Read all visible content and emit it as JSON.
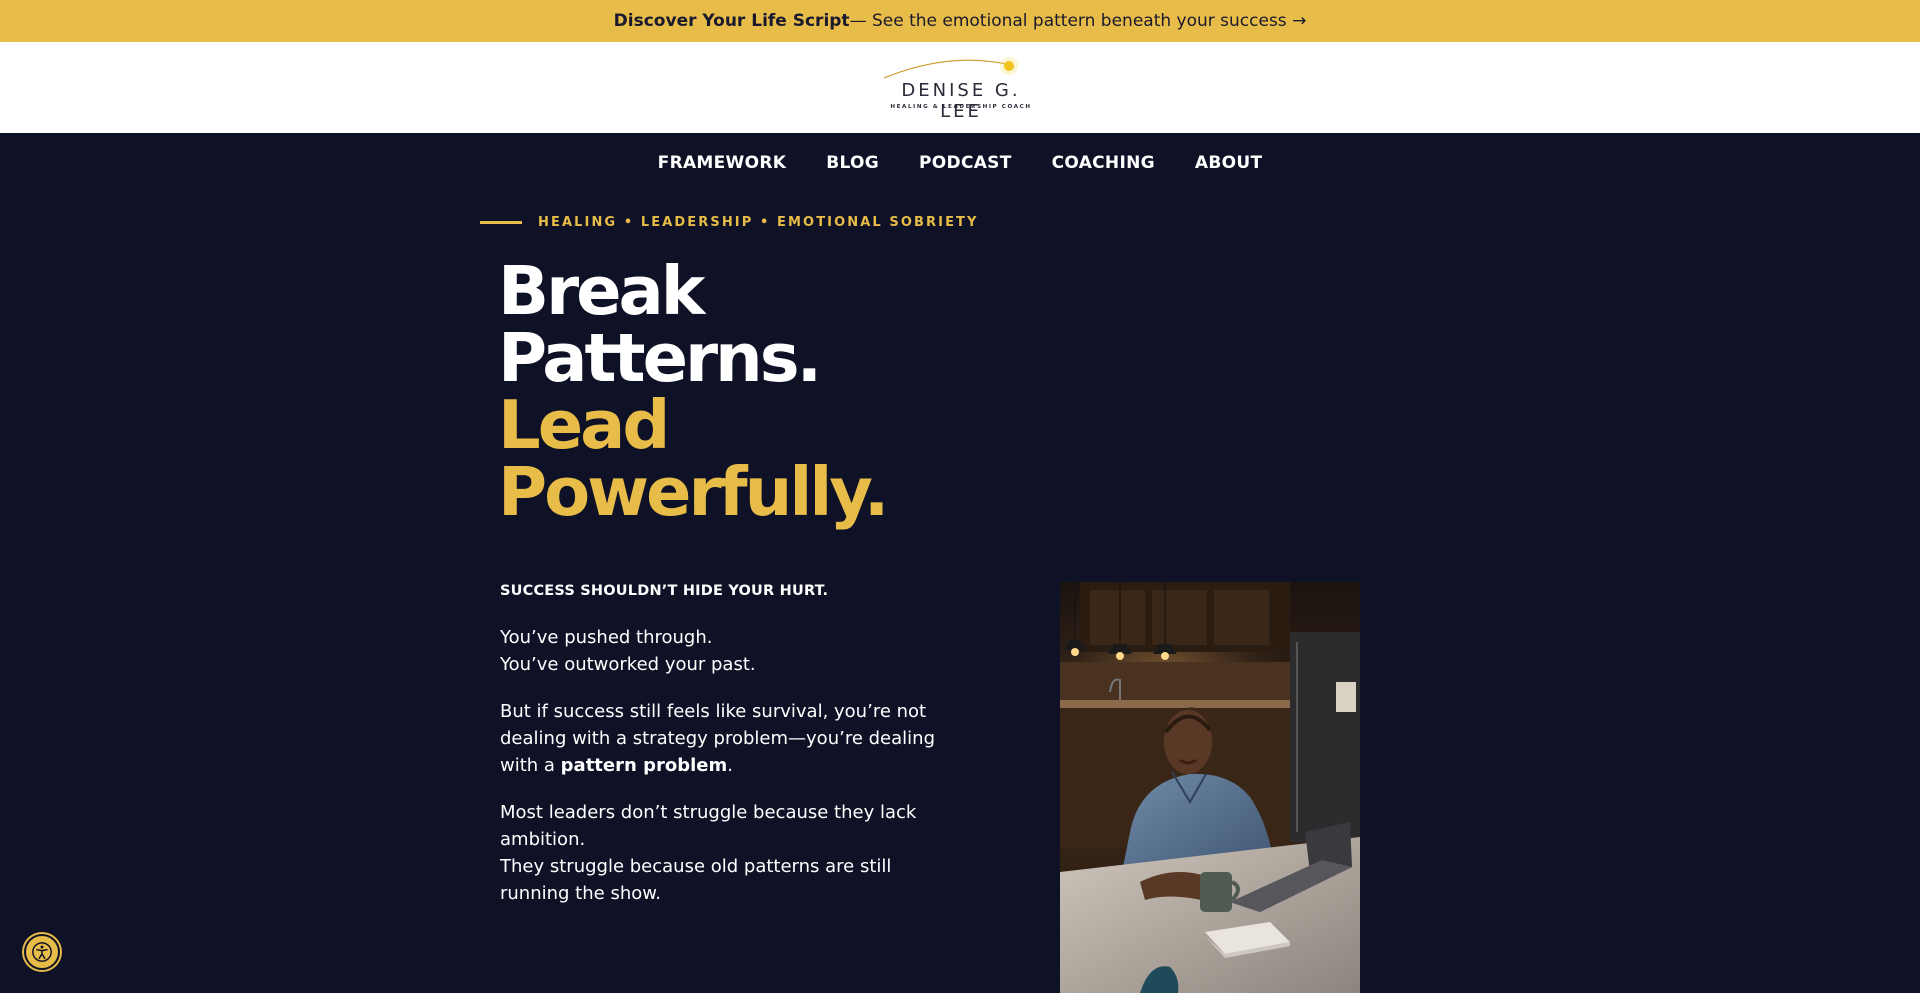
{
  "topbar": {
    "bold": "Discover Your Life Script",
    "rest": " — See the emotional pattern beneath your success →"
  },
  "logo": {
    "name": "DENISE G. LEE",
    "tagline": "HEALING & LEADERSHIP COACH"
  },
  "nav": {
    "items": [
      "FRAMEWORK",
      "BLOG",
      "PODCAST",
      "COACHING",
      "ABOUT"
    ]
  },
  "hero": {
    "eyebrow": "HEALING • LEADERSHIP • EMOTIONAL SOBRIETY",
    "headline_line1": "Break",
    "headline_line2": "Patterns.",
    "headline_line3": "Lead",
    "headline_line4": "Powerfully.",
    "kicker": "SUCCESS SHOULDN’T HIDE YOUR HURT.",
    "p1_line1": "You’ve pushed through.",
    "p1_line2": "You’ve outworked your past.",
    "p2_text": "But if success still feels like survival, you’re not dealing with a strategy problem—you’re dealing with a ",
    "p2_bold": "pattern problem",
    "p2_end": ".",
    "p3_line1": "Most leaders don’t struggle because they lack ambition.",
    "p3_line2": "They struggle because old patterns are still running the show."
  },
  "colors": {
    "accent": "#e8bc48",
    "background": "#0f1226",
    "header": "#ffffff"
  },
  "icons": {
    "accessibility": "accessibility-icon",
    "logo_sun": "sun-icon"
  }
}
